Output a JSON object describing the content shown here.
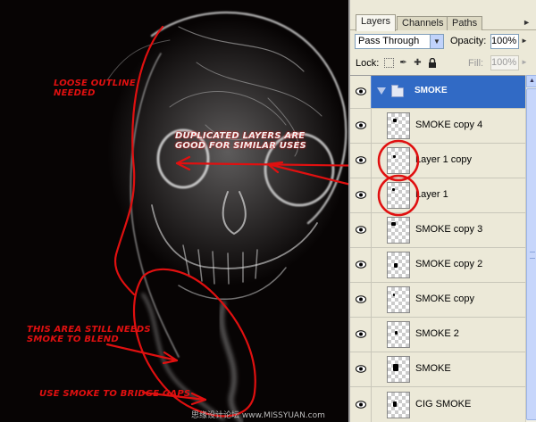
{
  "canvas": {
    "annotations": {
      "outline": "LOOSE OUTLINE\nNEEDED",
      "duplicated": "DUPLICATED LAYERS ARE\nGOOD FOR SIMILAR USES",
      "area": "THIS AREA STILL NEEDS\nSMOKE TO BLEND",
      "bridge": "USE SMOKE TO BRIDGE GAPS"
    },
    "watermark": "思缘设计论坛  www.MISSYUAN.com",
    "annotation_color": "#e01010"
  },
  "panel": {
    "tabs": [
      {
        "label": "Layers",
        "active": true
      },
      {
        "label": "Channels",
        "active": false
      },
      {
        "label": "Paths",
        "active": false
      }
    ],
    "blend_mode": "Pass Through",
    "opacity_label": "Opacity:",
    "opacity": "100%",
    "lock_label": "Lock:",
    "fill_label": "Fill:",
    "fill": "100%",
    "layers": [
      {
        "name": "SMOKE",
        "type": "group",
        "thumb": "folder-icon"
      },
      {
        "name": "SMOKE copy 4",
        "type": "layer"
      },
      {
        "name": "Layer 1 copy",
        "type": "layer"
      },
      {
        "name": "Layer 1",
        "type": "layer"
      },
      {
        "name": "SMOKE copy 3",
        "type": "layer"
      },
      {
        "name": "SMOKE copy 2",
        "type": "layer"
      },
      {
        "name": "SMOKE copy",
        "type": "layer"
      },
      {
        "name": "SMOKE 2",
        "type": "layer"
      },
      {
        "name": "SMOKE",
        "type": "layer"
      },
      {
        "name": "CIG SMOKE",
        "type": "layer"
      }
    ],
    "selection_color": "#316ac5"
  }
}
